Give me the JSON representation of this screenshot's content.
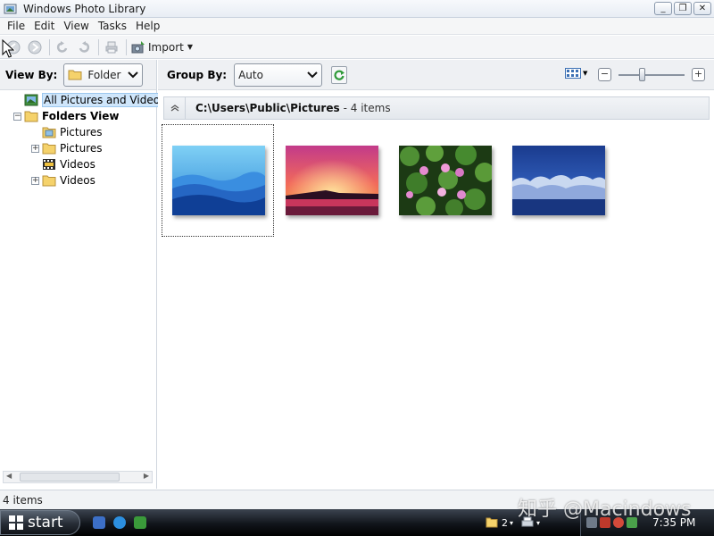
{
  "window": {
    "title": "Windows Photo Library",
    "controls": {
      "minimize": "_",
      "maximize": "❐",
      "close": "✕"
    }
  },
  "menu": [
    "File",
    "Edit",
    "View",
    "Tasks",
    "Help"
  ],
  "toolbar": {
    "import_label": "Import",
    "icons": [
      "back-icon",
      "forward-icon",
      "rotate-left-icon",
      "rotate-right-icon",
      "print-icon",
      "import-icon"
    ]
  },
  "left_panel": {
    "view_by_label": "View By:",
    "view_by_value": "Folder",
    "tree": [
      {
        "label": "All Pictures and Videos",
        "icon": "all-pictures-icon",
        "selected": true
      },
      {
        "label": "Folders View",
        "icon": "folder-icon",
        "expander": "−"
      },
      {
        "label": "Pictures",
        "icon": "pictures-folder-icon"
      },
      {
        "label": "Pictures",
        "icon": "folder-icon",
        "expander": "+"
      },
      {
        "label": "Videos",
        "icon": "videos-folder-icon"
      },
      {
        "label": "Videos",
        "icon": "folder-icon",
        "expander": "+"
      }
    ]
  },
  "main": {
    "group_by_label": "Group By:",
    "group_by_value": "Auto",
    "zoom": {
      "minus": "−",
      "plus": "+",
      "level": 0.35
    },
    "group": {
      "path": "C:\\Users\\Public\\Pictures",
      "count": "- 4 items"
    },
    "photos": [
      {
        "name": "blue-mountains-photo",
        "colors": [
          "#3aa6e6",
          "#1a63b9",
          "#0b3f8d"
        ]
      },
      {
        "name": "sunset-photo",
        "colors": [
          "#d6336d",
          "#f0524a",
          "#1a0b1f"
        ]
      },
      {
        "name": "water-lilies-photo",
        "colors": [
          "#3f7a2a",
          "#d870b8",
          "#1e3b14"
        ]
      },
      {
        "name": "frost-trees-photo",
        "colors": [
          "#1e3f94",
          "#6d8fd4",
          "#c9d7ee"
        ]
      }
    ]
  },
  "status": {
    "items": "4 items"
  },
  "taskbar": {
    "start_label": "start",
    "tray_count": "2",
    "clock": "7:35 PM"
  },
  "watermark": "知乎 @Macindows"
}
